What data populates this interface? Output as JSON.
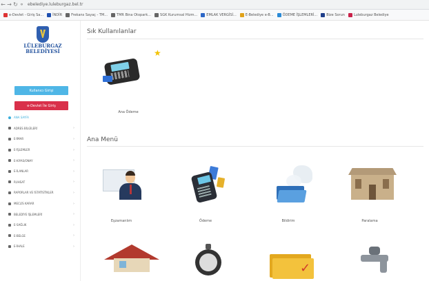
{
  "browser": {
    "url": "ebelediye.luleburgaz.bel.tr",
    "bookmarks": [
      "e-Devlet - Giriş Sa...",
      "İNDİR",
      "Frekans Sayaç - TM...",
      "TMR Bina Otopark...",
      "SGK Kurumsal Hizm...",
      "EMLAK VERGİSİ...",
      "E-Belediye e-B...",
      "ÖDEME İŞLEMLERİ...",
      "Bize Sorun",
      "Luleburgaz Belediye"
    ]
  },
  "sidebar": {
    "logo_line1": "LÜLEBURGAZ",
    "logo_line2": "BELEDİYESİ",
    "button_primary": "Kullanıcı Girişi",
    "button_secondary": "e-Devlet İle Giriş",
    "items": [
      {
        "label": "ANA SAYFA",
        "active": true
      },
      {
        "label": "ADRES BİLGİLERİ",
        "active": false
      },
      {
        "label": "E-İMAR",
        "active": false
      },
      {
        "label": "E-İŞLEMLER",
        "active": false
      },
      {
        "label": "E-KIYAS/ONAY",
        "active": false
      },
      {
        "label": "E-İLANLAR",
        "active": false
      },
      {
        "label": "RUHSAT",
        "active": false
      },
      {
        "label": "RAPORLAR VE İSTATİSTİKLER",
        "active": false
      },
      {
        "label": "MECLİS KARAR",
        "active": false
      },
      {
        "label": "BELEDİYE İŞLEMLERİ",
        "active": false
      },
      {
        "label": "E-SAĞLIK",
        "active": false
      },
      {
        "label": "E-BELGE",
        "active": false
      },
      {
        "label": "E-İHALE",
        "active": false
      }
    ]
  },
  "main": {
    "favorites_title": "Sık Kullanılanlar",
    "favorites": [
      {
        "label": "Ana Ödeme"
      }
    ],
    "menu_title": "Ana Menü",
    "menu_row1": [
      {
        "label": "Eşzamanlım"
      },
      {
        "label": "Ödeme"
      },
      {
        "label": "Bildirim"
      },
      {
        "label": "Paralama"
      }
    ],
    "menu_row2": [
      {
        "label": ""
      },
      {
        "label": ""
      },
      {
        "label": ""
      },
      {
        "label": ""
      }
    ]
  },
  "colors": {
    "accent": "#3aaedc",
    "primary_button": "#4fb6e6",
    "danger_button": "#d9304a",
    "logo": "#1f4f9c"
  },
  "icons": [
    "back-icon",
    "forward-icon",
    "reload-icon",
    "lock-icon",
    "star-icon",
    "pos-device-icon",
    "person-icon",
    "card-terminal-icon",
    "folder-icon",
    "building-icon",
    "house-icon",
    "stopwatch-icon",
    "checked-folder-icon",
    "tap-icon"
  ]
}
